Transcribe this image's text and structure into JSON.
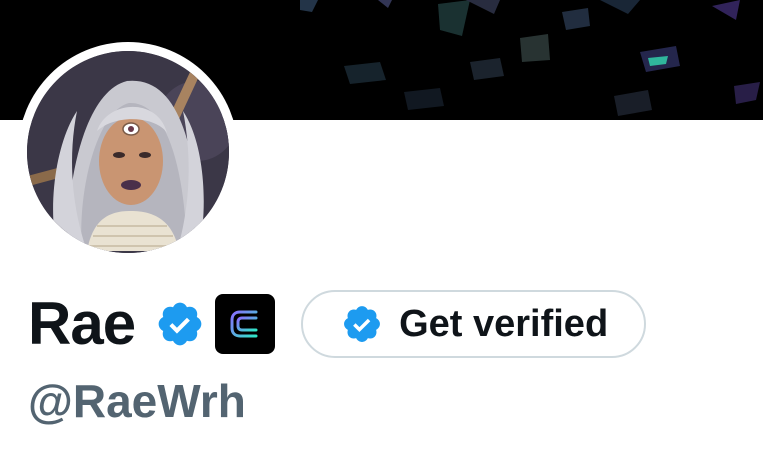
{
  "profile": {
    "display_name": "Rae",
    "handle": "@RaeWrh"
  },
  "badges": {
    "verified_icon": "verified-checkmark-icon",
    "affiliate_icon": "affiliate-logo-icon"
  },
  "actions": {
    "get_verified_label": "Get verified"
  },
  "colors": {
    "verified_blue": "#1d9bf0",
    "text_primary": "#0f1419",
    "text_secondary": "#536471",
    "button_border": "#cfd9de",
    "banner": "#000000"
  }
}
